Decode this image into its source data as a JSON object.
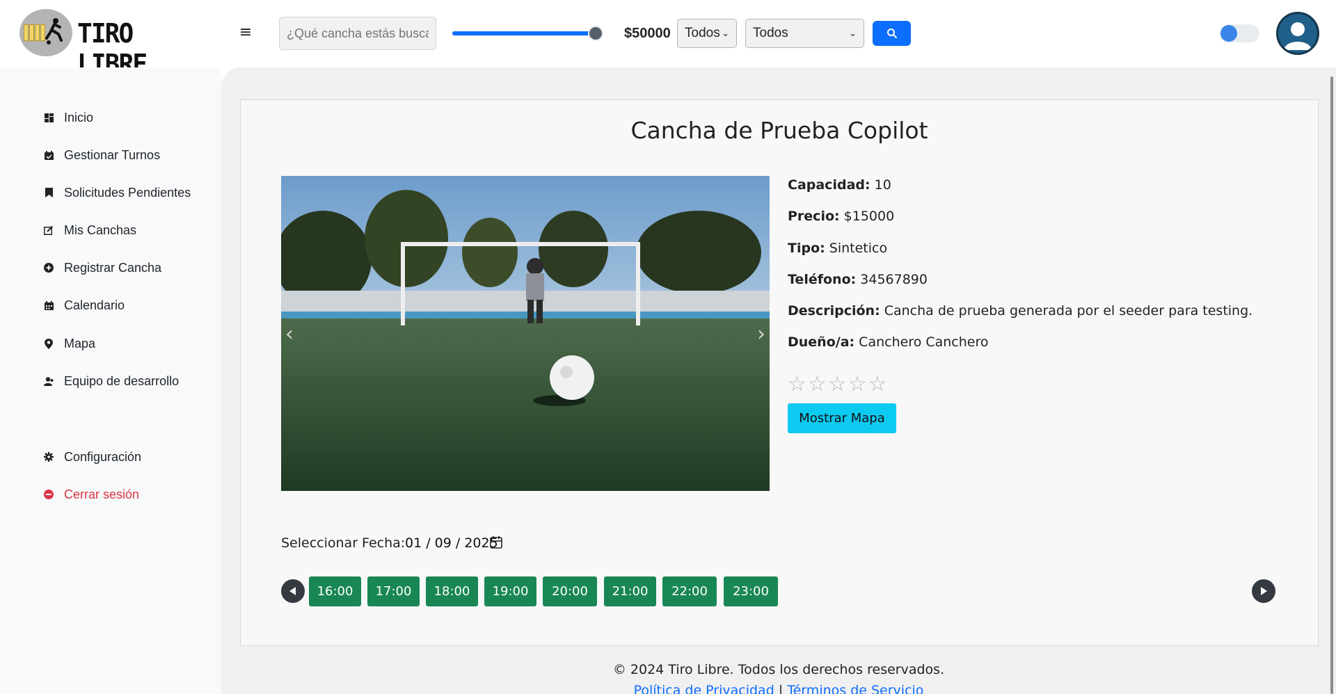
{
  "header": {
    "logo_text": "TIRO LIBRE",
    "search_placeholder": "¿Qué cancha estás buscando?",
    "price_value": "$50000",
    "price_slider_level": 1.0,
    "filter_1_value": "Todos",
    "filter_2_value": "Todos",
    "search_icon": "search-icon",
    "theme_toggle_on": true
  },
  "sidebar": {
    "items": [
      {
        "label": "Inicio",
        "icon": "dashboard-icon"
      },
      {
        "label": "Gestionar Turnos",
        "icon": "calendar-check-icon"
      },
      {
        "label": "Solicitudes Pendientes",
        "icon": "bookmark-icon"
      },
      {
        "label": "Mis Canchas",
        "icon": "edit-icon"
      },
      {
        "label": "Registrar Cancha",
        "icon": "plus-circle-icon"
      },
      {
        "label": "Calendario",
        "icon": "calendar-icon"
      },
      {
        "label": "Mapa",
        "icon": "map-pin-icon"
      },
      {
        "label": "Equipo de desarrollo",
        "icon": "team-icon"
      }
    ],
    "settings_label": "Configuración",
    "logout_label": "Cerrar sesión"
  },
  "court": {
    "title": "Cancha de Prueba Copilot",
    "fields": [
      {
        "label": "Capacidad:",
        "value": "10"
      },
      {
        "label": "Precio:",
        "value": "$15000"
      },
      {
        "label": "Tipo:",
        "value": "Sintetico"
      },
      {
        "label": "Teléfono:",
        "value": "34567890"
      },
      {
        "label": "Descripción:",
        "value": "Cancha de prueba generada por el seeder para testing."
      },
      {
        "label": "Dueño/a:",
        "value": "Canchero Canchero"
      }
    ],
    "rating": 0,
    "rating_max": 5,
    "map_button": "Mostrar Mapa"
  },
  "booking": {
    "date_label": "Seleccionar Fecha:",
    "date_value": "01 / 09 / 2025",
    "slots": [
      "16:00",
      "17:00",
      "18:00",
      "19:00",
      "20:00",
      "21:00",
      "22:00",
      "23:00"
    ]
  },
  "footer": {
    "copyright": "© 2024 Tiro Libre. Todos los derechos reservados.",
    "privacy_link": "Política de Privacidad",
    "separator": "|",
    "terms_link": "Términos de Servicio"
  },
  "colors": {
    "primary": "#0d6efd",
    "info": "#0dcaf0",
    "success": "#198754",
    "danger": "#dc3545"
  }
}
